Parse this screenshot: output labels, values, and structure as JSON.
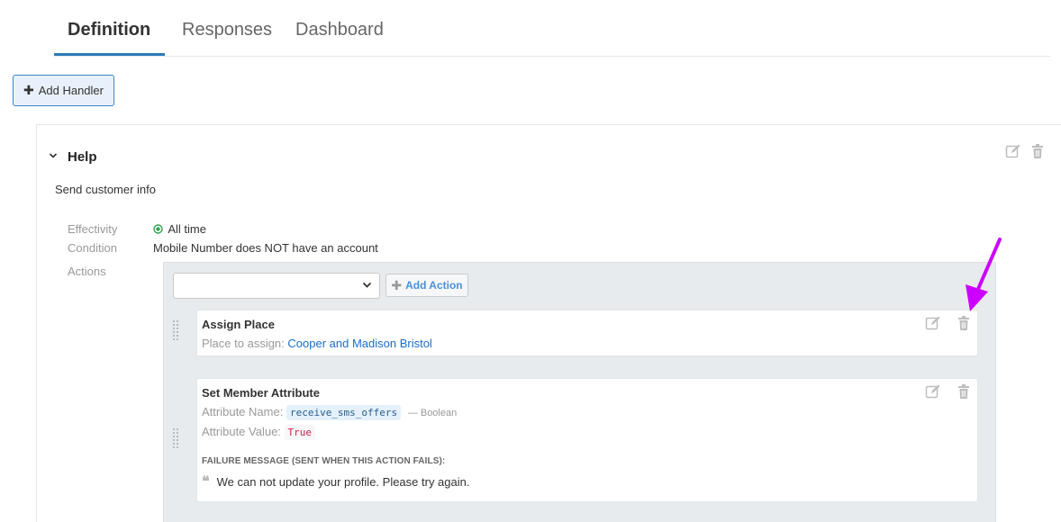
{
  "tabs": [
    {
      "label": "Definition",
      "active": true
    },
    {
      "label": "Responses",
      "active": false
    },
    {
      "label": "Dashboard",
      "active": false
    }
  ],
  "toolbar": {
    "add_handler_label": "Add Handler"
  },
  "handler": {
    "title": "Help",
    "description": "Send customer info",
    "effectivity_label": "Effectivity",
    "effectivity_value": "All time",
    "condition_label": "Condition",
    "condition_value": "Mobile Number does NOT have an account",
    "actions_label": "Actions"
  },
  "actions_panel": {
    "select_value": "",
    "add_action_label": "Add Action",
    "cards": [
      {
        "title": "Assign Place",
        "place_label": "Place to assign:",
        "place_value": "Cooper and Madison Bristol"
      },
      {
        "title": "Set Member Attribute",
        "attr_name_label": "Attribute Name:",
        "attr_name_value": "receive_sms_offers",
        "attr_type": "— Boolean",
        "attr_value_label": "Attribute Value:",
        "attr_value_value": "True",
        "failure_heading": "FAILURE MESSAGE (SENT WHEN THIS ACTION FAILS):",
        "failure_message": "We can not update your profile. Please try again."
      }
    ]
  },
  "colors": {
    "accent": "#2b7bb9",
    "annotation_arrow": "#cc00ff",
    "link": "#1a6ec7",
    "status_green": "#2ea44f"
  },
  "icons": [
    "plus-icon",
    "chevron-down-icon",
    "edit-icon",
    "trash-icon",
    "check-circle-icon",
    "caret-down-icon",
    "drag-handle-icon",
    "quote-icon",
    "annotation-arrow"
  ]
}
